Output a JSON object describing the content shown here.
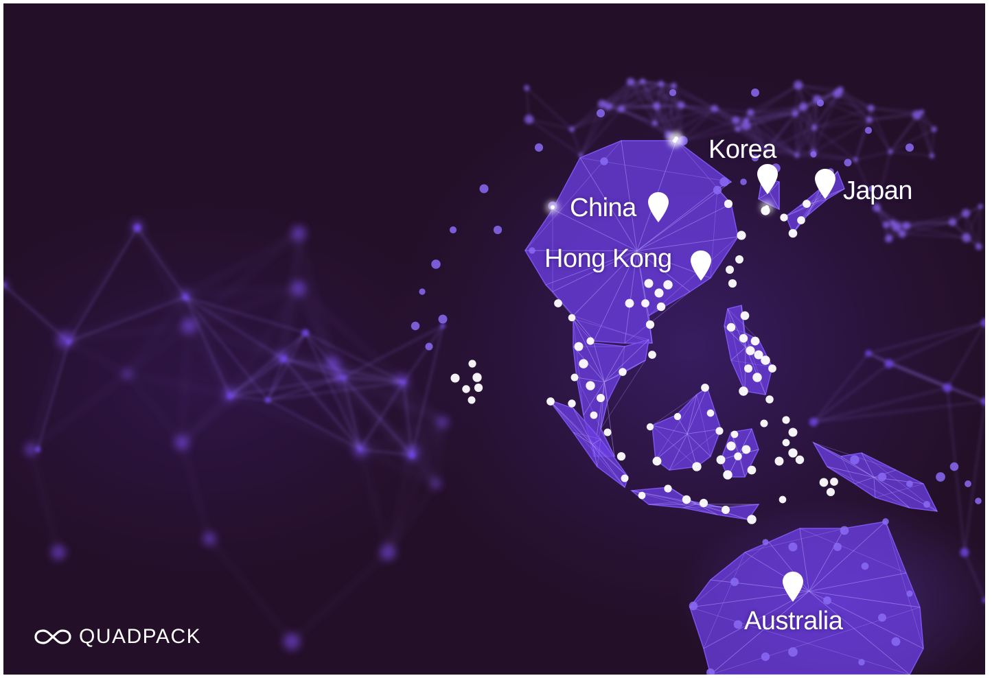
{
  "brand": {
    "name": "QUADPACK",
    "logo_icon": "infinity-logo-icon"
  },
  "locations": [
    {
      "id": "korea",
      "label": "Korea",
      "icon": "map-pin-icon"
    },
    {
      "id": "japan",
      "label": "Japan",
      "icon": "map-pin-icon"
    },
    {
      "id": "china",
      "label": "China",
      "icon": "map-pin-icon"
    },
    {
      "id": "hong-kong",
      "label": "Hong Kong",
      "icon": "map-pin-icon"
    },
    {
      "id": "australia",
      "label": "Australia",
      "icon": "map-pin-icon"
    }
  ],
  "colors": {
    "background": "#230f27",
    "land": "#6a3ee0",
    "land_light": "#7c52f0",
    "node": "#ffffff",
    "node_dim": "#8a6af5",
    "line": "#9b7cff",
    "text": "#ffffff"
  }
}
